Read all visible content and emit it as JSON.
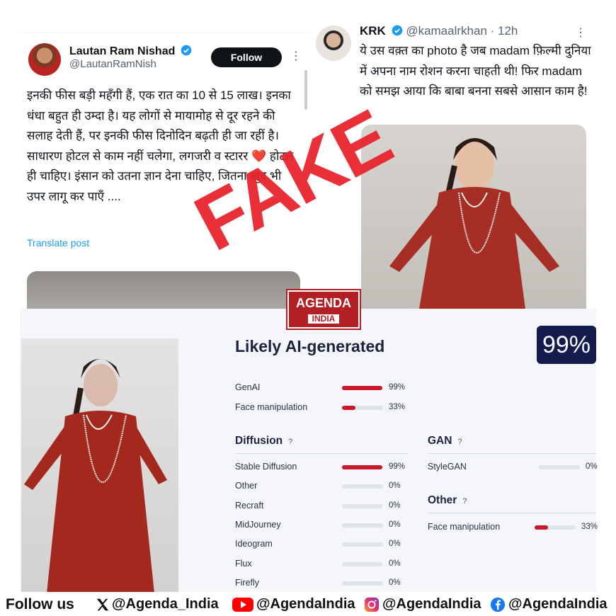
{
  "tweet1": {
    "name": "Lautan Ram Nishad",
    "handle": "@LautanRamNish",
    "follow_label": "Follow",
    "more": "⋮",
    "text": "इनकी फीस बड़ी महँगी हैं, एक रात का 10 से 15 लाख। इनका धंधा बहुत ही उम्दा है। यह लोगों से मायामोह से दूर रहने की सलाह देती हैं, पर इनकी फीस दिनोदिन बढ़ती ही जा रहीं है। साधारण होटल से काम नहीं चलेगा, लगजरी व स्टारर ❤️ होटल ही चाहिए। इंसान को उतना ज्ञान देना चाहिए, जितना खुद भी उपर लागू कर पाएँ ....",
    "translate_label": "Translate post"
  },
  "tweet2": {
    "name": "KRK",
    "handle": "@kamaalrkhan",
    "time": "· 12h",
    "more": "⋮",
    "text": "ये उस वक़्त का photo है जब madam फ़िल्मी दुनिया में अपना नाम रोशन करना चाहती थी! फिर madam को समझ आया कि बाबा बनना सबसे आसान काम है!"
  },
  "stamp": {
    "text": "FAKE",
    "color": "#e8212b"
  },
  "logo": {
    "line1": "AGENDA",
    "line2": "INDIA"
  },
  "detector": {
    "title": "Likely AI-generated",
    "score": "99%",
    "top": [
      {
        "label": "GenAI",
        "pct": "99%",
        "value": 0.99
      },
      {
        "label": "Face manipulation",
        "pct": "33%",
        "value": 0.33
      }
    ],
    "diffusion": {
      "title": "Diffusion",
      "help": "?",
      "items": [
        {
          "label": "Stable Diffusion",
          "pct": "99%",
          "value": 0.99
        },
        {
          "label": "Other",
          "pct": "0%",
          "value": 0
        },
        {
          "label": "Recraft",
          "pct": "0%",
          "value": 0
        },
        {
          "label": "MidJourney",
          "pct": "0%",
          "value": 0
        },
        {
          "label": "Ideogram",
          "pct": "0%",
          "value": 0
        },
        {
          "label": "Flux",
          "pct": "0%",
          "value": 0
        },
        {
          "label": "Firefly",
          "pct": "0%",
          "value": 0
        }
      ]
    },
    "gan": {
      "title": "GAN",
      "help": "?",
      "items": [
        {
          "label": "StyleGAN",
          "pct": "0%",
          "value": 0
        }
      ]
    },
    "other": {
      "title": "Other",
      "help": "?",
      "items": [
        {
          "label": "Face manipulation",
          "pct": "33%",
          "value": 0.33
        }
      ]
    },
    "bar_color": "#c8192c"
  },
  "footer": {
    "follow": "Follow us",
    "x_handle": "@Agenda_India",
    "yt_handle": "@AgendaIndia",
    "ig_handle": "@AgendaIndia",
    "fb_handle": "@AgendaIndia"
  }
}
